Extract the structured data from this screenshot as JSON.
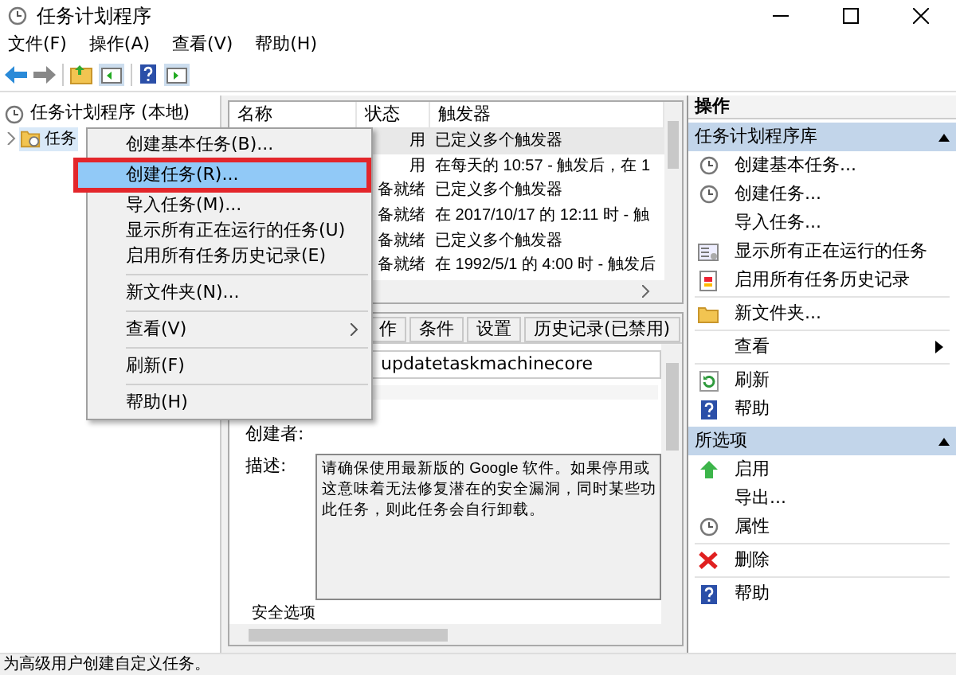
{
  "window": {
    "title": "任务计划程序"
  },
  "menu_bar": [
    "文件(F)",
    "操作(A)",
    "查看(V)",
    "帮助(H)"
  ],
  "tree": [
    {
      "label": "任务计划程序 (本地)",
      "children": [
        {
          "label": "任务",
          "expanded": false,
          "selected": true
        }
      ]
    }
  ],
  "task_list": {
    "columns": [
      "名称",
      "状态",
      "触发器"
    ],
    "rows": [
      {
        "status": "用",
        "trigger": "已定义多个触发器",
        "selected": true
      },
      {
        "status": "用",
        "trigger": "在每天的 10:57 - 触发后，在 1",
        "selected": false
      },
      {
        "status": "备就绪",
        "trigger": "已定义多个触发器",
        "selected": false
      },
      {
        "status": "备就绪",
        "trigger": "在 2017/10/17 的 12:11 时 - 触",
        "selected": false
      },
      {
        "status": "备就绪",
        "trigger": "已定义多个触发器",
        "selected": false
      },
      {
        "status": "备就绪",
        "trigger": "在 1992/5/1 的 4:00 时 - 触发后",
        "selected": false
      }
    ]
  },
  "details": {
    "tabs": [
      {
        "label": "作",
        "selected": false
      },
      {
        "label": "条件",
        "selected": false
      },
      {
        "label": "设置",
        "selected": false
      },
      {
        "label": "历史记录(已禁用)",
        "selected": false
      }
    ],
    "name_value": "updatetaskmachinecore",
    "creator_label": "创建者:",
    "description_label": "描述:",
    "description": [
      "请确保使用最新版的 Google 软件。如果停用或",
      "这意味着无法修复潜在的安全漏洞，同时某些功",
      "此任务，则此任务会自行卸载。"
    ],
    "section_label": "安全选项"
  },
  "context_menu": [
    {
      "kind": "item",
      "label": "创建基本任务(B)...",
      "selected": false
    },
    {
      "kind": "item",
      "label": "创建任务(R)...",
      "selected": true
    },
    {
      "kind": "item",
      "label": "导入任务(M)...",
      "selected": false
    },
    {
      "kind": "item",
      "label": "显示所有正在运行的任务(U)",
      "selected": false
    },
    {
      "kind": "item",
      "label": "启用所有任务历史记录(E)",
      "selected": false
    },
    {
      "kind": "separator"
    },
    {
      "kind": "item",
      "label": "新文件夹(N)...",
      "selected": false
    },
    {
      "kind": "separator"
    },
    {
      "kind": "submenu",
      "label": "查看(V)",
      "selected": false
    },
    {
      "kind": "separator"
    },
    {
      "kind": "item",
      "label": "刷新(F)",
      "selected": false
    },
    {
      "kind": "separator"
    },
    {
      "kind": "item",
      "label": "帮助(H)",
      "selected": false
    }
  ],
  "actions": {
    "title": "操作",
    "sections": [
      {
        "title": "任务计划程序库",
        "expanded": true,
        "items": [
          {
            "kind": "item",
            "label": "创建基本任务..."
          },
          {
            "kind": "item",
            "label": "创建任务..."
          },
          {
            "kind": "item",
            "label": "导入任务..."
          },
          {
            "kind": "item",
            "label": "显示所有正在运行的任务"
          },
          {
            "kind": "item",
            "label": "启用所有任务历史记录"
          },
          {
            "kind": "separator"
          },
          {
            "kind": "item",
            "label": "新文件夹..."
          },
          {
            "kind": "separator"
          },
          {
            "kind": "submenu",
            "label": "查看"
          },
          {
            "kind": "separator"
          },
          {
            "kind": "item",
            "label": "刷新"
          },
          {
            "kind": "item",
            "label": "帮助"
          }
        ]
      },
      {
        "title": "所选项",
        "expanded": true,
        "items": [
          {
            "kind": "item",
            "label": "启用"
          },
          {
            "kind": "item",
            "label": "导出..."
          },
          {
            "kind": "item",
            "label": "属性"
          },
          {
            "kind": "separator"
          },
          {
            "kind": "item",
            "label": "删除"
          },
          {
            "kind": "separator"
          },
          {
            "kind": "item",
            "label": "帮助"
          }
        ]
      }
    ]
  },
  "status_bar": "为高级用户创建自定义任务。"
}
